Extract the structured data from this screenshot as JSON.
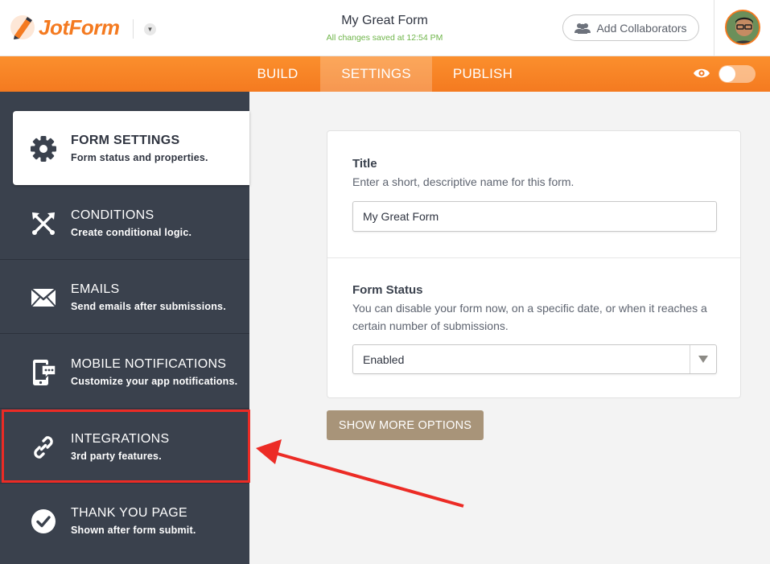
{
  "header": {
    "logo_text": "JotForm",
    "form_title": "My Great Form",
    "save_status": "All changes saved at 12:54 PM",
    "collab_label": "Add Collaborators"
  },
  "nav": {
    "tabs": [
      "BUILD",
      "SETTINGS",
      "PUBLISH"
    ],
    "active_tab": "SETTINGS"
  },
  "sidebar": {
    "items": [
      {
        "title": "FORM SETTINGS",
        "subtitle": "Form status and properties.",
        "icon": "gear-icon"
      },
      {
        "title": "CONDITIONS",
        "subtitle": "Create conditional logic.",
        "icon": "conditions-icon"
      },
      {
        "title": "EMAILS",
        "subtitle": "Send emails after submissions.",
        "icon": "envelope-icon"
      },
      {
        "title": "MOBILE NOTIFICATIONS",
        "subtitle": "Customize your app notifications.",
        "icon": "mobile-notification-icon"
      },
      {
        "title": "INTEGRATIONS",
        "subtitle": "3rd party features.",
        "icon": "link-icon"
      },
      {
        "title": "THANK YOU PAGE",
        "subtitle": "Shown after form submit.",
        "icon": "checkmark-icon"
      }
    ]
  },
  "settings": {
    "title_label": "Title",
    "title_desc": "Enter a short, descriptive name for this form.",
    "title_value": "My Great Form",
    "status_label": "Form Status",
    "status_desc": "You can disable your form now, on a specific date, or when it reaches a certain number of submissions.",
    "status_value": "Enabled",
    "more_button": "SHOW MORE OPTIONS"
  },
  "colors": {
    "brand_orange": "#f47a20",
    "sidebar_bg": "#3a414d",
    "highlight_red": "#ec2b25",
    "button_tan": "#a89479"
  }
}
